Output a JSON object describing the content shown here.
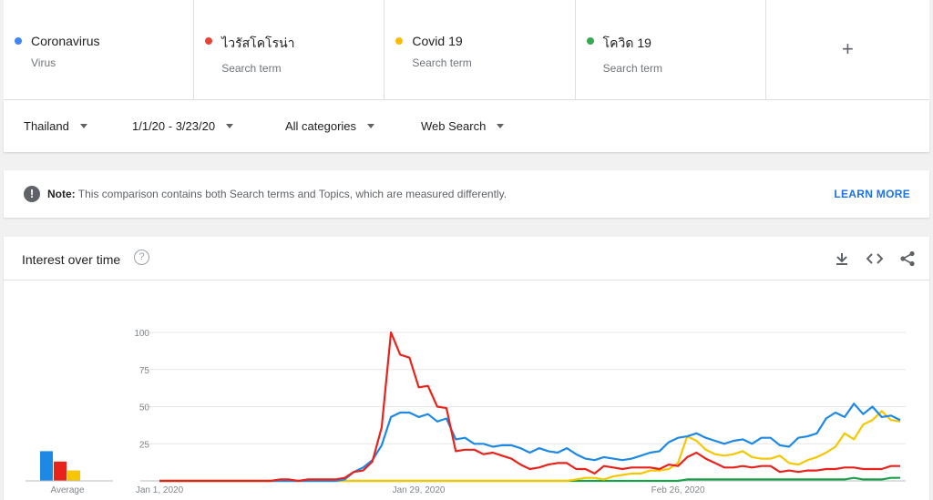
{
  "terms": [
    {
      "name": "Coronavirus",
      "sub": "Virus",
      "color": "#4285f4"
    },
    {
      "name": "ไวรัสโคโรน่า",
      "sub": "Search term",
      "color": "#ea4335"
    },
    {
      "name": "Covid 19",
      "sub": "Search term",
      "color": "#fbbc04"
    },
    {
      "name": "โควิด 19",
      "sub": "Search term",
      "color": "#34a853"
    }
  ],
  "add_term_icon": "plus-icon",
  "filters": {
    "region": "Thailand",
    "date_range": "1/1/20 - 3/23/20",
    "category": "All categories",
    "search_type": "Web Search"
  },
  "note": {
    "label": "Note:",
    "message": "This comparison contains both Search terms and Topics, which are measured differently.",
    "link": "LEARN MORE"
  },
  "card": {
    "title": "Interest over time",
    "help_icon": "help-icon",
    "download_icon": "download-icon",
    "embed_icon": "embed-icon",
    "share_icon": "share-icon"
  },
  "chart_data": {
    "type": "line",
    "ylim": [
      0,
      100
    ],
    "yticks": [
      "100",
      "75",
      "50",
      "25"
    ],
    "x_ticks": [
      {
        "label": "Jan 1, 2020",
        "index": 0
      },
      {
        "label": "Jan 29, 2020",
        "index": 28
      },
      {
        "label": "Feb 26, 2020",
        "index": 56
      }
    ],
    "average": {
      "label": "Average",
      "values": [
        20,
        13,
        7
      ]
    },
    "series": [
      {
        "name": "Coronavirus",
        "color": "#1e88e5",
        "values": [
          0,
          0,
          0,
          0,
          0,
          0,
          0,
          0,
          0,
          0,
          0,
          0,
          0,
          0,
          0,
          0,
          0,
          0,
          0,
          0,
          1,
          6,
          9,
          14,
          24,
          43,
          46,
          46,
          43,
          45,
          40,
          42,
          28,
          29,
          25,
          25,
          23,
          24,
          24,
          22,
          19,
          22,
          20,
          19,
          22,
          18,
          15,
          14,
          16,
          15,
          14,
          15,
          17,
          19,
          20,
          26,
          29,
          30,
          32,
          29,
          27,
          25,
          27,
          28,
          25,
          29,
          29,
          24,
          23,
          29,
          30,
          32,
          42,
          46,
          43,
          52,
          45,
          50,
          43,
          44,
          41
        ]
      },
      {
        "name": "ไวรัสโคโรน่า",
        "color": "#e8231c",
        "values": [
          0,
          0,
          0,
          0,
          0,
          0,
          0,
          0,
          0,
          0,
          0,
          0,
          0,
          1,
          1,
          0,
          1,
          1,
          1,
          1,
          2,
          6,
          7,
          13,
          36,
          100,
          85,
          83,
          63,
          64,
          50,
          49,
          20,
          21,
          21,
          18,
          19,
          17,
          15,
          11,
          8,
          9,
          11,
          12,
          12,
          8,
          8,
          5,
          10,
          9,
          8,
          9,
          9,
          9,
          8,
          11,
          10,
          16,
          19,
          15,
          12,
          9,
          9,
          10,
          9,
          10,
          10,
          6,
          7,
          6,
          7,
          7,
          8,
          8,
          9,
          9,
          8,
          8,
          8,
          10,
          10
        ]
      },
      {
        "name": "Covid 19",
        "color": "#f6c700",
        "values": [
          0,
          0,
          0,
          0,
          0,
          0,
          0,
          0,
          0,
          0,
          0,
          0,
          0,
          0,
          0,
          0,
          0,
          0,
          0,
          0,
          0,
          0,
          0,
          0,
          0,
          0,
          0,
          0,
          0,
          0,
          0,
          0,
          0,
          0,
          0,
          0,
          0,
          0,
          0,
          0,
          0,
          0,
          0,
          0,
          0,
          1,
          2,
          2,
          1,
          3,
          4,
          5,
          5,
          7,
          7,
          8,
          12,
          30,
          27,
          21,
          18,
          17,
          18,
          20,
          16,
          15,
          15,
          17,
          12,
          11,
          14,
          16,
          19,
          23,
          32,
          28,
          38,
          41,
          47,
          41,
          40
        ]
      },
      {
        "name": "โควิด 19",
        "color": "#1aa04a",
        "values": [
          0,
          0,
          0,
          0,
          0,
          0,
          0,
          0,
          0,
          0,
          0,
          0,
          0,
          0,
          0,
          0,
          0,
          0,
          0,
          0,
          0,
          0,
          0,
          0,
          0,
          0,
          0,
          0,
          0,
          0,
          0,
          0,
          0,
          0,
          0,
          0,
          0,
          0,
          0,
          0,
          0,
          0,
          0,
          0,
          0,
          0,
          0,
          0,
          0,
          0,
          0,
          0,
          0,
          0,
          0,
          0,
          0,
          1,
          1,
          1,
          1,
          1,
          1,
          1,
          1,
          1,
          1,
          1,
          1,
          1,
          1,
          1,
          1,
          1,
          1,
          2,
          1,
          1,
          1,
          2,
          2
        ]
      }
    ]
  }
}
